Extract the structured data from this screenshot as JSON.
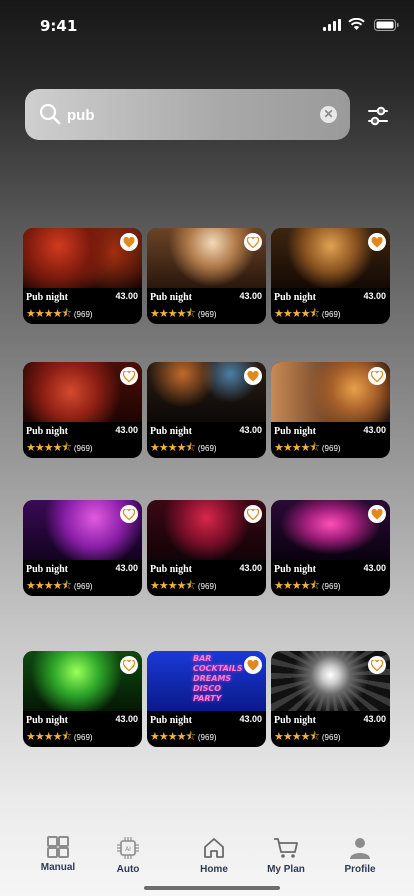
{
  "status_bar": {
    "time": "9:41"
  },
  "search": {
    "value": "pub"
  },
  "cards": [
    {
      "name": "Pub night",
      "price": "43.00",
      "rating": 4.5,
      "count": "(969)",
      "favorite": true
    },
    {
      "name": "Pub night",
      "price": "43.00",
      "rating": 4.5,
      "count": "(969)",
      "favorite": false
    },
    {
      "name": "Pub night",
      "price": "43.00",
      "rating": 4.5,
      "count": "(969)",
      "favorite": true
    },
    {
      "name": "Pub night",
      "price": "43.00",
      "rating": 4.5,
      "count": "(969)",
      "favorite": false
    },
    {
      "name": "Pub night",
      "price": "43.00",
      "rating": 4.5,
      "count": "(969)",
      "favorite": true
    },
    {
      "name": "Pub night",
      "price": "43.00",
      "rating": 4.5,
      "count": "(969)",
      "favorite": false
    },
    {
      "name": "Pub night",
      "price": "43.00",
      "rating": 4.5,
      "count": "(969)",
      "favorite": false
    },
    {
      "name": "Pub night",
      "price": "43.00",
      "rating": 4.5,
      "count": "(969)",
      "favorite": false
    },
    {
      "name": "Pub night",
      "price": "43.00",
      "rating": 4.5,
      "count": "(969)",
      "favorite": true
    },
    {
      "name": "Pub night",
      "price": "43.00",
      "rating": 4.5,
      "count": "(969)",
      "favorite": false
    },
    {
      "name": "Pub night",
      "price": "43.00",
      "rating": 4.5,
      "count": "(969)",
      "favorite": true
    },
    {
      "name": "Pub night",
      "price": "43.00",
      "rating": 4.5,
      "count": "(969)",
      "favorite": false
    }
  ],
  "neon_sign": [
    "BAR",
    "COCKTAILS",
    "DREAMS",
    "DISCO",
    "PARTY"
  ],
  "nav": [
    {
      "label": "Manual",
      "icon": "grid-icon"
    },
    {
      "label": "Auto",
      "icon": "ai-chip-icon"
    },
    {
      "label": "Home",
      "icon": "home-icon"
    },
    {
      "label": "My Plan",
      "icon": "cart-icon"
    },
    {
      "label": "Profile",
      "icon": "profile-icon"
    }
  ],
  "colors": {
    "star": "#f2b33b",
    "favorite_heart": "#e08a1e",
    "nav_text": "#2e3a52"
  }
}
